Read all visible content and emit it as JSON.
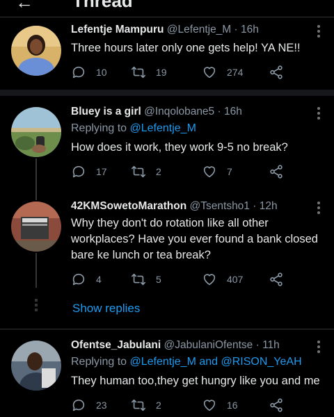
{
  "header": {
    "title": "Thread",
    "back_icon": "arrow-left-icon"
  },
  "colors": {
    "background": "#000000",
    "text": "#e7e9ea",
    "muted": "#8b98a5",
    "link": "#1d9bf0",
    "separator": "#16181c"
  },
  "tweets": [
    {
      "name": "Lefentje Mampuru",
      "handle": "@Lefentje_M",
      "time": "· 16h",
      "reply_prefix": "",
      "reply_handles": "",
      "text": "Three hours later only one gets help! YA NE!!",
      "replies": "10",
      "retweets": "19",
      "likes": "274"
    },
    {
      "name": "Bluey is a girl",
      "handle": "@Inqolobane5",
      "time": "· 16h",
      "reply_prefix": "Replying to ",
      "reply_handles": "@Lefentje_M",
      "text": "How does it work, they work 9-5 no break?",
      "replies": "17",
      "retweets": "2",
      "likes": "7"
    },
    {
      "name": "42KMSowetoMarathon",
      "handle": "@Tsentsho1",
      "time": "· 12h",
      "reply_prefix": "",
      "reply_handles": "",
      "text": "Why they don't do rotation like all other workplaces? Have you ever found a bank closed bare ke lunch or tea break?",
      "replies": "4",
      "retweets": "5",
      "likes": "407",
      "show_replies": "Show replies"
    },
    {
      "name": "Ofentse_Jabulani",
      "handle": "@JabulaniOfentse",
      "time": "· 11h",
      "reply_prefix": "Replying to ",
      "reply_handles": "@Lefentje_M and @RISON_YeAH",
      "text": "They human too,they get hungry like you and me",
      "replies": "23",
      "retweets": "2",
      "likes": "16"
    }
  ]
}
